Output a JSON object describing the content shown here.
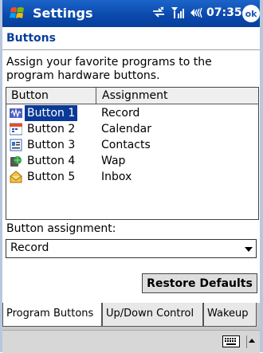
{
  "titlebar": {
    "title": "Settings",
    "time": "07:35",
    "ok_label": "ok",
    "icons": [
      "start-flag-icon",
      "connectivity-icon",
      "signal-icon",
      "volume-icon"
    ]
  },
  "page": {
    "title": "Buttons",
    "description": "Assign your favorite programs to the program hardware buttons."
  },
  "list": {
    "headers": [
      "Button",
      "Assignment"
    ],
    "rows": [
      {
        "name": "Button 1",
        "assignment": "Record",
        "icon": "record-icon",
        "selected": true
      },
      {
        "name": "Button 2",
        "assignment": "Calendar",
        "icon": "calendar-icon",
        "selected": false
      },
      {
        "name": "Button 3",
        "assignment": "Contacts",
        "icon": "contacts-icon",
        "selected": false
      },
      {
        "name": "Button 4",
        "assignment": "Wap",
        "icon": "wap-icon",
        "selected": false
      },
      {
        "name": "Button 5",
        "assignment": "Inbox",
        "icon": "inbox-icon",
        "selected": false
      }
    ]
  },
  "assignment": {
    "label": "Button assignment:",
    "value": "Record"
  },
  "restore_label": "Restore Defaults",
  "tabs": [
    {
      "label": "Program Buttons",
      "active": true
    },
    {
      "label": "Up/Down Control",
      "active": false
    },
    {
      "label": "Wakeup",
      "active": false
    }
  ],
  "bottom": {
    "icons": [
      "keyboard-icon",
      "input-menu-arrow-icon"
    ]
  },
  "colors": {
    "titlebar": "#0a48aa",
    "selection": "#0a3a96",
    "heading": "#0a3f9a"
  }
}
